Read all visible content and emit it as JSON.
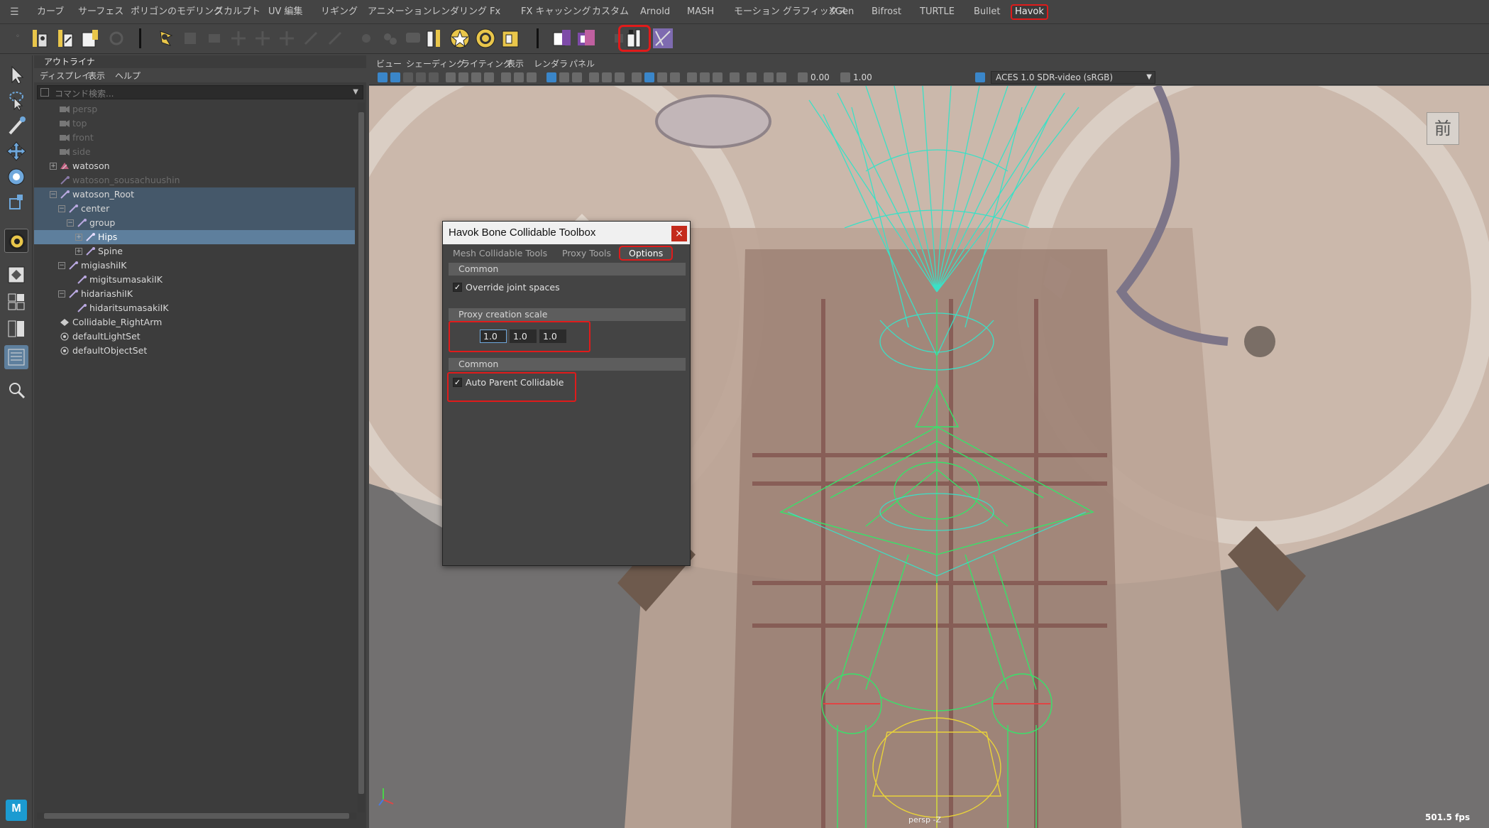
{
  "shelf_tabs": [
    "カーブ",
    "サーフェス",
    "ポリゴンのモデリング",
    "スカルプト",
    "UV 編集",
    "リギング",
    "アニメーション",
    "レンダリング",
    "Fx",
    "FX キャッシング",
    "カスタム",
    "Arnold",
    "MASH",
    "モーション グラフィックス",
    "XGen",
    "Bifrost",
    "TURTLE",
    "Bullet",
    "Havok"
  ],
  "active_shelf_tab": "Havok",
  "outliner": {
    "tab_label": "アウトライナ",
    "menu": [
      "ディスプレイ",
      "表示",
      "ヘルプ"
    ],
    "search_placeholder": "コマンド検索...",
    "items": [
      {
        "label": "persp",
        "icon": "camera-icon",
        "dim": true
      },
      {
        "label": "top",
        "icon": "camera-icon",
        "dim": true
      },
      {
        "label": "front",
        "icon": "camera-icon",
        "dim": true
      },
      {
        "label": "side",
        "icon": "camera-icon",
        "dim": true
      },
      {
        "label": "watoson",
        "icon": "mesh-icon",
        "dim": false
      },
      {
        "label": "watoson_sousachuushin",
        "icon": "joint-icon",
        "dim": true
      },
      {
        "label": "watoson_Root",
        "icon": "joint-icon",
        "dim": false
      },
      {
        "label": "center",
        "icon": "joint-icon",
        "dim": false
      },
      {
        "label": "group",
        "icon": "joint-icon",
        "dim": false
      },
      {
        "label": "Hips",
        "icon": "joint-icon",
        "dim": false
      },
      {
        "label": "Spine",
        "icon": "joint-icon",
        "dim": false
      },
      {
        "label": "migiashiIK",
        "icon": "joint-icon",
        "dim": false
      },
      {
        "label": "migitsumasakiIK",
        "icon": "joint-icon",
        "dim": false
      },
      {
        "label": "hidariashiIK",
        "icon": "joint-icon",
        "dim": false
      },
      {
        "label": "hidaritsumasakiIK",
        "icon": "joint-icon",
        "dim": false
      },
      {
        "label": "Collidable_RightArm",
        "icon": "collidable-icon",
        "dim": false
      },
      {
        "label": "defaultLightSet",
        "icon": "set-icon",
        "dim": false
      },
      {
        "label": "defaultObjectSet",
        "icon": "set-icon",
        "dim": false
      }
    ]
  },
  "viewport": {
    "menu": [
      "ビュー",
      "シェーディング",
      "ライティング",
      "表示",
      "レンダラ",
      "パネル"
    ],
    "exposure": "0.00",
    "gamma": "1.00",
    "color_space": "ACES 1.0 SDR-video (sRGB)",
    "view_cube_label": "前",
    "camera_label": "persp -Z",
    "fps": "501.5 fps"
  },
  "dialog": {
    "title": "Havok Bone Collidable Toolbox",
    "close": "×",
    "tabs": [
      "Mesh Collidable Tools",
      "Proxy Tools",
      "Options"
    ],
    "active_tab": "Options",
    "section1_header": "Common",
    "override_joint_spaces_label": "Override joint spaces",
    "override_joint_spaces_checked": true,
    "proxy_scale_header": "Proxy creation scale",
    "proxy_scale_values": [
      "1.0",
      "1.0",
      "1.0"
    ],
    "section2_header": "Common",
    "auto_parent_label": "Auto Parent Collidable",
    "auto_parent_checked": true,
    "check_mark": "✓"
  },
  "colors": {
    "highlight_red": "#e01b1b",
    "selection_blue": "#5e7f9d",
    "wireframe_cyan": "#3be0c6",
    "wireframe_green": "#38e26a",
    "wireframe_yellow": "#e8d23a"
  }
}
